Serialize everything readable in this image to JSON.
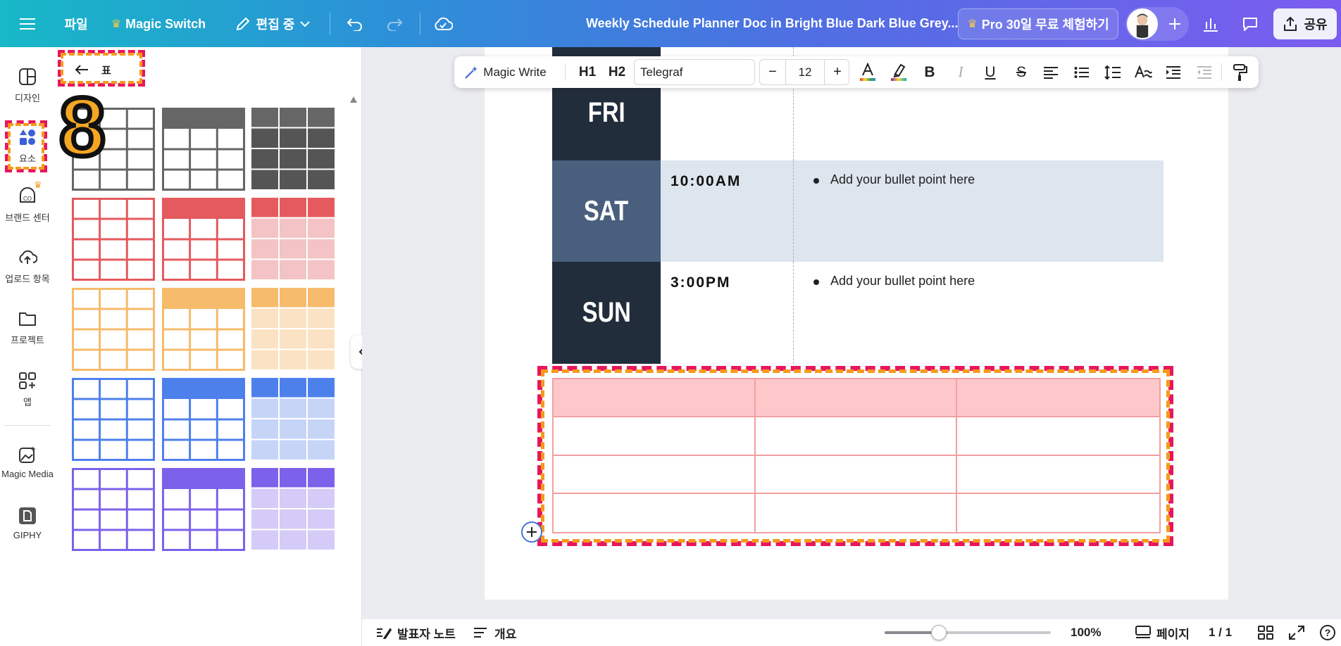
{
  "topbar": {
    "menu_icon": "hamburger-icon",
    "file_label": "파일",
    "magic_switch_label": "Magic Switch",
    "editing_label": "편집 중",
    "doc_title": "Weekly Schedule Planner Doc in Bright Blue Dark Blue Grey...",
    "pro_trial_label": "Pro 30일 무료 체험하기",
    "share_label": "공유"
  },
  "rail": {
    "items": [
      {
        "label": "디자인",
        "icon": "design-icon"
      },
      {
        "label": "요소",
        "icon": "elements-icon"
      },
      {
        "label": "브랜드 센터",
        "icon": "brand-icon"
      },
      {
        "label": "업로드 항목",
        "icon": "upload-icon"
      },
      {
        "label": "프로젝트",
        "icon": "folder-icon"
      },
      {
        "label": "앱",
        "icon": "apps-icon"
      },
      {
        "label": "Magic Media",
        "icon": "magic-media-icon"
      },
      {
        "label": "GIPHY",
        "icon": "giphy-icon"
      }
    ]
  },
  "panel": {
    "back_label": "표",
    "step_number": "8"
  },
  "table_styles": [
    {
      "color": "#666666",
      "light": "#cccccc"
    },
    {
      "color": "#e45a5e",
      "light": "#f4c3c5"
    },
    {
      "color": "#f6bb6b",
      "light": "#fce2c4"
    },
    {
      "color": "#4e80ec",
      "light": "#c6d4f8"
    },
    {
      "color": "#7c62ea",
      "light": "#d4cbf8"
    }
  ],
  "text_toolbar": {
    "magic_write_label": "Magic Write",
    "h1_label": "H1",
    "h2_label": "H2",
    "font_name": "Telegraf",
    "font_size": "12"
  },
  "schedule": {
    "rows": [
      {
        "day": "FRI",
        "time": "",
        "bullet": ""
      },
      {
        "day": "SAT",
        "time": "10:00AM",
        "bullet": "Add your bullet point here"
      },
      {
        "day": "SUN",
        "time": "3:00PM",
        "bullet": "Add your bullet point here"
      }
    ]
  },
  "new_table": {
    "header_color": "#fec8cb",
    "border_color": "#f39ea3",
    "rows": 4,
    "cols": 3
  },
  "bottombar": {
    "notes_label": "발표자 노트",
    "overview_label": "개요",
    "zoom_value": "100%",
    "page_label": "페이지",
    "page_count": "1 / 1"
  },
  "colors": {
    "dark_navy": "#222d3c",
    "slate": "#4a5f7e",
    "light_blue_row": "#dde5ee",
    "highlight_pink": "#e8165c",
    "highlight_orange": "#f59a1b"
  }
}
